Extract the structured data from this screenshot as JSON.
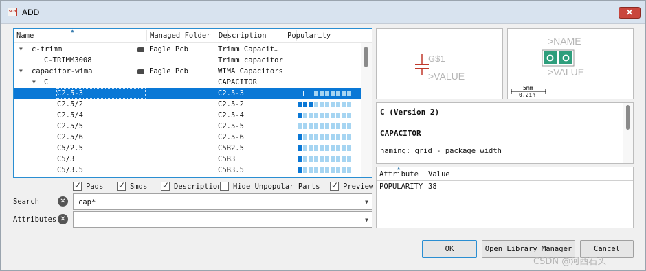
{
  "window": {
    "title": "ADD",
    "app_icon_text": "SCH",
    "close_glyph": "✕"
  },
  "table": {
    "columns": {
      "name": "Name",
      "folder": "Managed Folder",
      "description": "Description",
      "popularity": "Popularity"
    },
    "rows": [
      {
        "name": "c-trimm",
        "folder": "Eagle Pcb",
        "description": "Trimm Capacit…",
        "expander": "▼",
        "popularity": null
      },
      {
        "name": "C-TRIMM3008",
        "folder": "",
        "description": "Trimm capacitor",
        "expander": "",
        "popularity": null
      },
      {
        "name": "capacitor-wima",
        "folder": "Eagle Pcb",
        "description": "WIMA Capacitors",
        "expander": "▼",
        "popularity": null
      },
      {
        "name": "C",
        "folder": "",
        "description": "CAPACITOR",
        "expander": "▼",
        "popularity": null
      },
      {
        "name": "C2.5-3",
        "folder": "",
        "description": "C2.5-3",
        "expander": "",
        "popularity": 0,
        "selected": true
      },
      {
        "name": "C2.5/2",
        "folder": "",
        "description": "C2.5-2",
        "expander": "",
        "popularity": 3
      },
      {
        "name": "C2.5/4",
        "folder": "",
        "description": "C2.5-4",
        "expander": "",
        "popularity": 1
      },
      {
        "name": "C2.5/5",
        "folder": "",
        "description": "C2.5-5",
        "expander": "",
        "popularity": 0
      },
      {
        "name": "C2.5/6",
        "folder": "",
        "description": "C2.5-6",
        "expander": "",
        "popularity": 1
      },
      {
        "name": "C5/2.5",
        "folder": "",
        "description": "C5B2.5",
        "expander": "",
        "popularity": 1
      },
      {
        "name": "C5/3",
        "folder": "",
        "description": "C5B3",
        "expander": "",
        "popularity": 1
      },
      {
        "name": "C5/3.5",
        "folder": "",
        "description": "C5B3.5",
        "expander": "",
        "popularity": 1
      }
    ]
  },
  "filters": {
    "pads": {
      "label": "Pads",
      "checked": true
    },
    "smds": {
      "label": "Smds",
      "checked": true
    },
    "description": {
      "label": "Description",
      "checked": true
    },
    "hide_unpopular": {
      "label": "Hide Unpopular Parts",
      "checked": false
    },
    "preview": {
      "label": "Preview",
      "checked": true
    }
  },
  "search": {
    "label": "Search",
    "value": "cap*"
  },
  "attributes_filter": {
    "label": "Attributes",
    "value": ""
  },
  "symbol_preview": {
    "name": "G$1",
    "value": ">VALUE"
  },
  "package_preview": {
    "name": ">NAME",
    "value": ">VALUE",
    "scale_top": "5mm",
    "scale_bottom": "0.2in"
  },
  "description_panel": {
    "title": "C (Version 2)",
    "part": "CAPACITOR",
    "naming": "naming: grid - package width"
  },
  "attributes_table": {
    "columns": {
      "attribute": "Attribute",
      "value": "Value"
    },
    "rows": [
      {
        "attribute": "POPULARITY",
        "value": "38"
      }
    ]
  },
  "buttons": {
    "ok": "OK",
    "open_library_manager": "Open Library Manager",
    "cancel": "Cancel"
  },
  "watermark": "CSDN @河西石头",
  "colors": {
    "selection": "#0a78d6",
    "pop_on": "#0a78d6",
    "pop_off": "#a6d5f2",
    "symbol_red": "#c0392b",
    "pad_green": "#2e9e7c"
  }
}
